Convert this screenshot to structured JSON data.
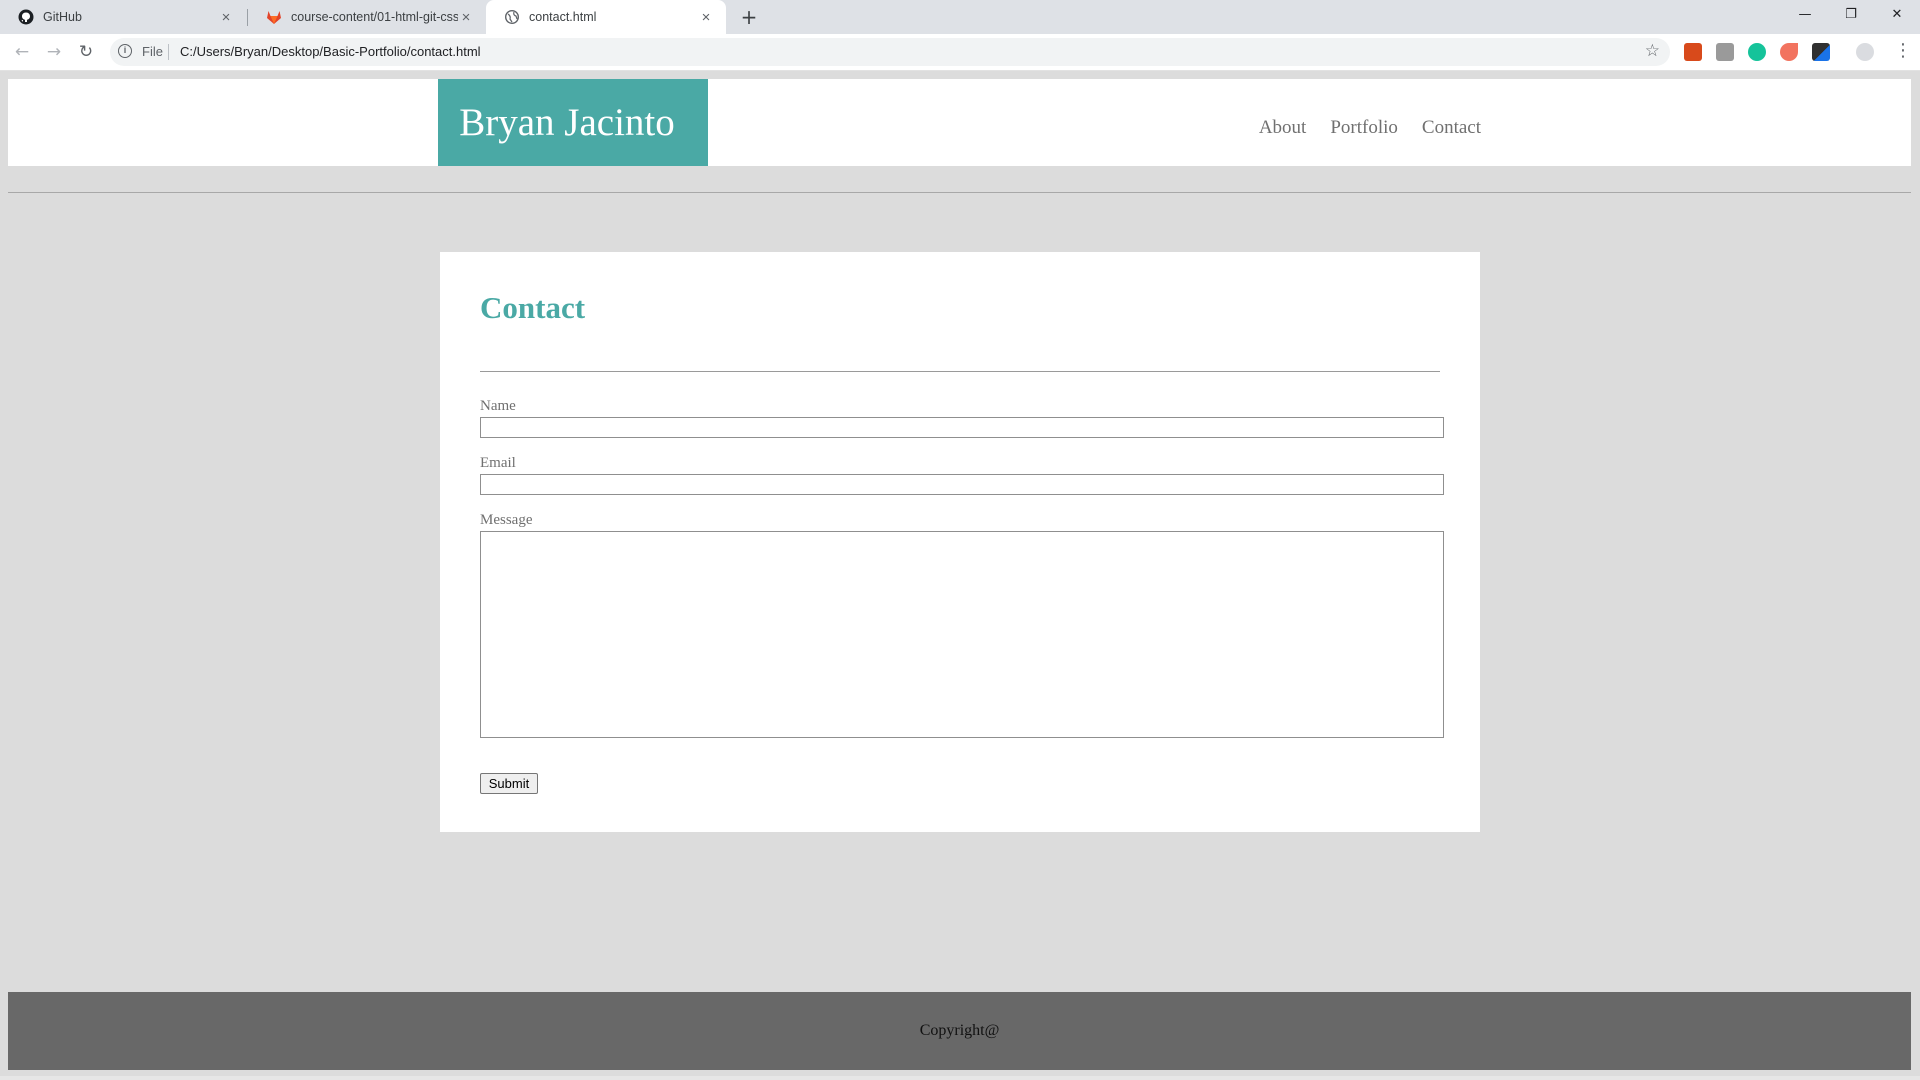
{
  "browser": {
    "tabs": [
      {
        "label": "GitHub",
        "icon": "github-icon"
      },
      {
        "label": "course-content/01-html-git-css/",
        "icon": "gitlab-icon"
      },
      {
        "label": "contact.html",
        "icon": "globe-icon",
        "active": true
      }
    ],
    "address": {
      "scheme_label": "File",
      "url": "C:/Users/Bryan/Desktop/Basic-Portfolio/contact.html"
    }
  },
  "site": {
    "brand": "Bryan Jacinto",
    "nav": [
      "About",
      "Portfolio",
      "Contact"
    ],
    "accent_color": "#4aa9a5"
  },
  "contact": {
    "heading": "Contact",
    "name_label": "Name",
    "email_label": "Email",
    "message_label": "Message",
    "submit_label": "Submit"
  },
  "footer": {
    "text": "Copyright@"
  }
}
